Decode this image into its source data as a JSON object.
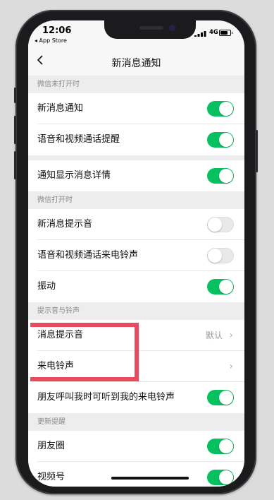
{
  "status_bar": {
    "time": "12:06",
    "back_app": "◂ App Store",
    "network": "4G"
  },
  "nav": {
    "title": "新消息通知"
  },
  "sections": [
    {
      "title": "微信未打开时",
      "rows": [
        {
          "label": "新消息通知",
          "toggle": "on"
        },
        {
          "label": "语音和视频通话提醒",
          "toggle": "on"
        }
      ]
    },
    {
      "title": "",
      "rows": [
        {
          "label": "通知显示消息详情",
          "toggle": "on"
        }
      ]
    },
    {
      "title": "微信打开时",
      "rows": [
        {
          "label": "新消息提示音",
          "toggle": "off"
        },
        {
          "label": "语音和视频通话来电铃声",
          "toggle": "off"
        },
        {
          "label": "振动",
          "toggle": "on"
        }
      ]
    },
    {
      "title": "提示音与铃声",
      "rows": [
        {
          "label": "消息提示音",
          "value": "默认"
        },
        {
          "label": "来电铃声",
          "value": ""
        },
        {
          "label": "朋友呼叫我时可听到我的来电铃声",
          "toggle": "on"
        }
      ]
    },
    {
      "title": "更新提醒",
      "rows": [
        {
          "label": "朋友圈",
          "toggle": "on"
        },
        {
          "label": "视频号",
          "toggle": "on"
        }
      ]
    }
  ],
  "colors": {
    "toggle_on": "#07c160",
    "highlight": "#e84a5f"
  },
  "icons": {
    "back": "chevron-left-icon",
    "disclosure": "chevron-right-icon"
  }
}
